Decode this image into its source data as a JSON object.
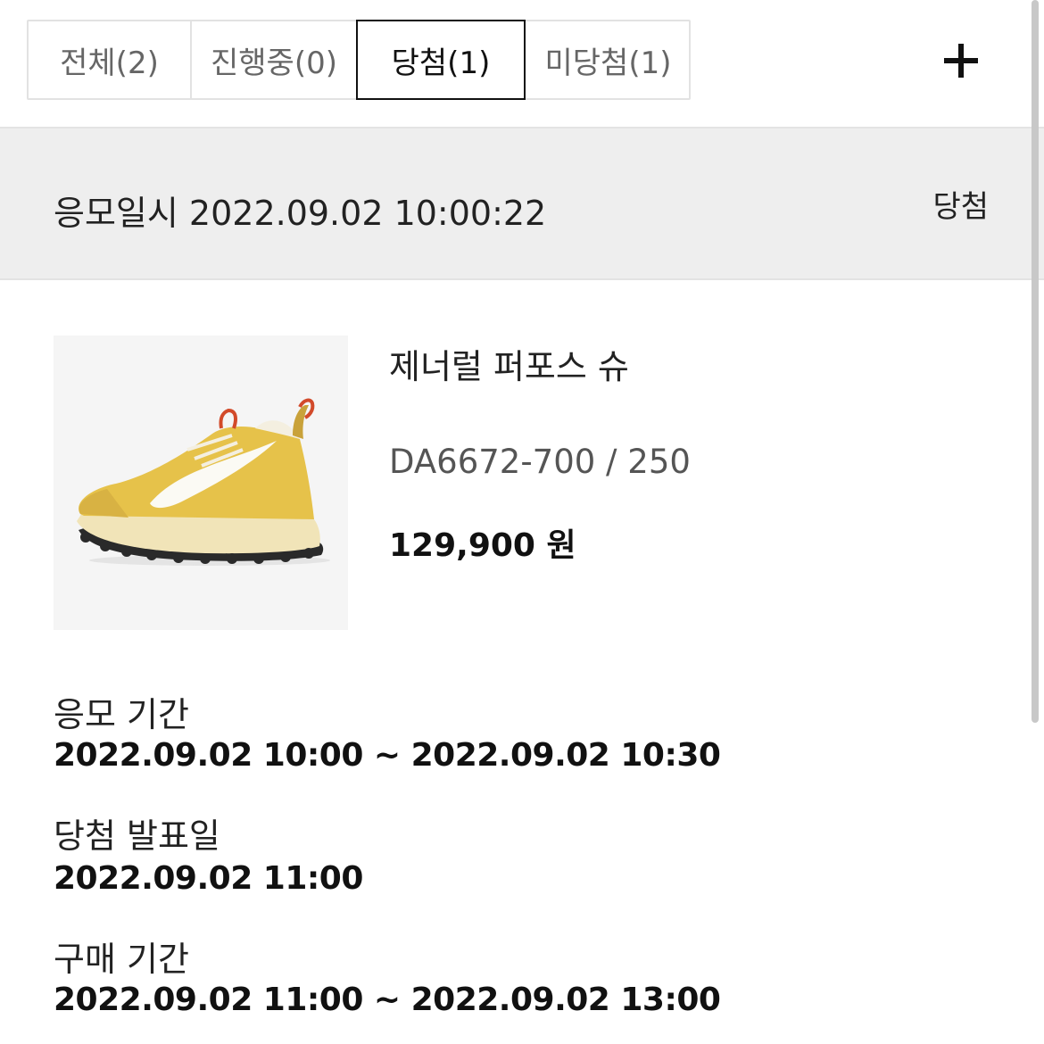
{
  "tabs": [
    {
      "label": "전체(2)"
    },
    {
      "label": "진행중(0)"
    },
    {
      "label": "당첨(1)"
    },
    {
      "label": "미당첨(1)"
    }
  ],
  "active_tab": "당첨(1)",
  "add_icon": "plus-icon",
  "entry": {
    "label": "응모일시 2022.09.02 10:00:22",
    "status": "당첨"
  },
  "product": {
    "name": "제너럴 퍼포스 슈",
    "code_size": "DA6672-700 / 250",
    "price": "129,900 원",
    "image_icon": "sneaker-image",
    "colors": {
      "shoe_upper": "#e6c24a",
      "swoosh": "#fbfaf4",
      "pull_tab": "#d24a2a",
      "sole": "#f1e4b8",
      "outsole": "#2a2a2a"
    }
  },
  "details": [
    {
      "label": "응모 기간",
      "value": "2022.09.02 10:00 ~ 2022.09.02 10:30"
    },
    {
      "label": "당첨 발표일",
      "value": "2022.09.02 11:00"
    },
    {
      "label": "구매 기간",
      "value": "2022.09.02 11:00 ~ 2022.09.02 13:00"
    }
  ]
}
